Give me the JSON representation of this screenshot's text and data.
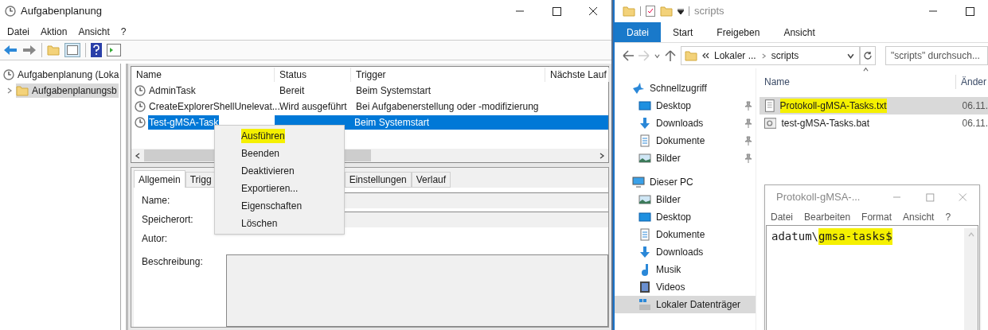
{
  "scheduler": {
    "title": "Aufgabenplanung",
    "menu": [
      "Datei",
      "Aktion",
      "Ansicht",
      "?"
    ],
    "tree": [
      {
        "label": "Aufgabenplanung (Loka",
        "children": [
          {
            "label": "Aufgabenplanungsb",
            "selected": true,
            "expanded": false
          }
        ]
      }
    ],
    "columns": [
      "Name",
      "Status",
      "Trigger",
      "Nächste Lauf"
    ],
    "rows": [
      {
        "name": "AdminTask",
        "status": "Bereit",
        "trigger": "Beim Systemstart",
        "selected": false
      },
      {
        "name": "CreateExplorerShellUnelevat...",
        "status": "Wird ausgeführt",
        "trigger": "Bei Aufgabenerstellung oder -modifizierung",
        "selected": false
      },
      {
        "name": "Test-gMSA-Task",
        "trigger": "Beim Systemstart",
        "selected": true
      }
    ],
    "tabs": [
      {
        "label": "Allgemein",
        "selected": true
      },
      {
        "label": "Trigg",
        "selected": false
      },
      {
        "label": "Einstellungen",
        "selected": false
      },
      {
        "label": "Verlauf",
        "selected": false
      }
    ],
    "fields": [
      {
        "label": "Name:",
        "kind": "box"
      },
      {
        "label": "Speicherort:",
        "kind": "box"
      },
      {
        "label": "Autor:",
        "kind": "plain"
      },
      {
        "label": "Beschreibung:",
        "kind": "area"
      }
    ],
    "context_menu": [
      {
        "label": "Ausführen",
        "highlighted": true
      },
      {
        "label": "Beenden",
        "highlighted": false
      },
      {
        "label": "Deaktivieren",
        "highlighted": false
      },
      {
        "label": "Exportieren...",
        "highlighted": false
      },
      {
        "label": "Eigenschaften",
        "highlighted": false
      },
      {
        "label": "Löschen",
        "highlighted": false
      }
    ]
  },
  "explorer": {
    "title": "scripts",
    "ribbon_tabs": [
      {
        "label": "Datei",
        "selected": true
      },
      {
        "label": "Start",
        "selected": false
      },
      {
        "label": "Freigeben",
        "selected": false
      },
      {
        "label": "Ansicht",
        "selected": false
      }
    ],
    "breadcrumb": [
      "Lokaler ...",
      "scripts"
    ],
    "search": {
      "placeholder": "\"scripts\" durchsuch..."
    },
    "nav": [
      {
        "label": "Schnellzugriff",
        "kind": "star",
        "selected": false,
        "children": [
          {
            "label": "Desktop",
            "kind": "desktop",
            "pinned": true,
            "selected": false
          },
          {
            "label": "Downloads",
            "kind": "download",
            "pinned": true,
            "selected": false
          },
          {
            "label": "Dokumente",
            "kind": "document",
            "pinned": true,
            "selected": false
          },
          {
            "label": "Bilder",
            "kind": "picture",
            "pinned": true,
            "selected": false
          }
        ]
      },
      {
        "label": "Dieser PC",
        "kind": "pc",
        "selected": false,
        "children": [
          {
            "label": "Bilder",
            "kind": "picture",
            "pinned": false,
            "selected": false
          },
          {
            "label": "Desktop",
            "kind": "desktop",
            "pinned": false,
            "selected": false
          },
          {
            "label": "Dokumente",
            "kind": "document",
            "pinned": false,
            "selected": false
          },
          {
            "label": "Downloads",
            "kind": "download",
            "pinned": false,
            "selected": false
          },
          {
            "label": "Musik",
            "kind": "music",
            "pinned": false,
            "selected": false
          },
          {
            "label": "Videos",
            "kind": "video",
            "pinned": false,
            "selected": false
          },
          {
            "label": "Lokaler Datenträger",
            "kind": "drive",
            "pinned": false,
            "selected": true
          }
        ]
      }
    ],
    "columns": [
      "Name",
      "Änder"
    ],
    "files": [
      {
        "name": "Protokoll-gMSA-Tasks.txt",
        "date": "06.11.",
        "kind": "text",
        "selected": true,
        "highlighted": true
      },
      {
        "name": "test-gMSA-Tasks.bat",
        "date": "06.11.",
        "kind": "batch",
        "selected": false,
        "highlighted": false
      }
    ]
  },
  "notepad": {
    "title": "Protokoll-gMSA-...",
    "menu": [
      "Datei",
      "Bearbeiten",
      "Format",
      "Ansicht",
      "?"
    ],
    "content": [
      {
        "text": "adatum\\",
        "highlighted": false
      },
      {
        "text": "gmsa-tasks$",
        "highlighted": true
      }
    ]
  }
}
